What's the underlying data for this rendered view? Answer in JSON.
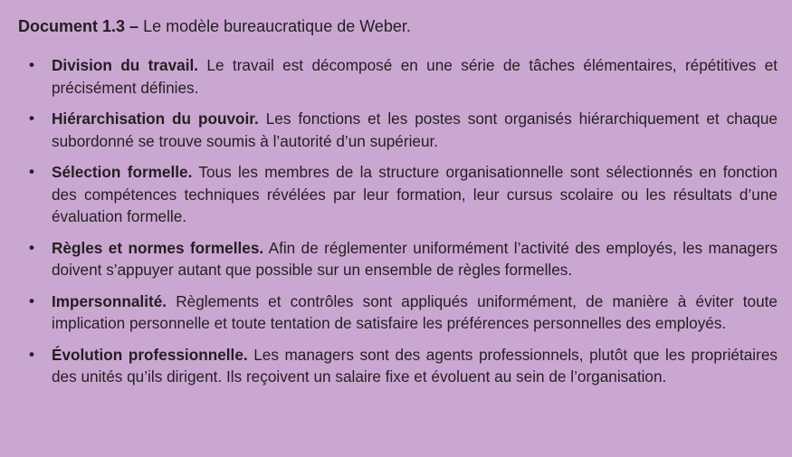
{
  "document": {
    "ref": "Document 1.3 –",
    "title": "Le modèle bureaucratique de Weber."
  },
  "items": [
    {
      "term": "Division du travail.",
      "text": "Le travail est décomposé en une série de tâches élémentaires, répétitives et précisément définies."
    },
    {
      "term": "Hiérarchisation du pouvoir.",
      "text": "Les fonctions et les postes sont organisés hiérarchiquement et chaque subordonné se trouve soumis à l’autorité d’un supérieur."
    },
    {
      "term": "Sélection formelle.",
      "text": "Tous les membres de la structure organisationnelle sont sélectionnés en fonction des compétences techniques révélées par leur formation, leur cursus scolaire ou les résultats d’une évaluation formelle."
    },
    {
      "term": "Règles et normes formelles.",
      "text": "Afin de réglementer uniformément l’activité des employés, les managers doivent s’appuyer autant que possible sur un ensemble de règles formelles."
    },
    {
      "term": "Impersonnalité.",
      "text": "Règlements et contrôles sont appliqués uniformément, de manière à éviter toute implication personnelle et toute tentation de satisfaire les préférences personnelles des employés."
    },
    {
      "term": "Évolution professionnelle.",
      "text": "Les managers sont des agents professionnels, plutôt que les propriétaires des unités qu’ils dirigent. Ils reçoivent un salaire fixe et évoluent au sein de l’organisation."
    }
  ]
}
